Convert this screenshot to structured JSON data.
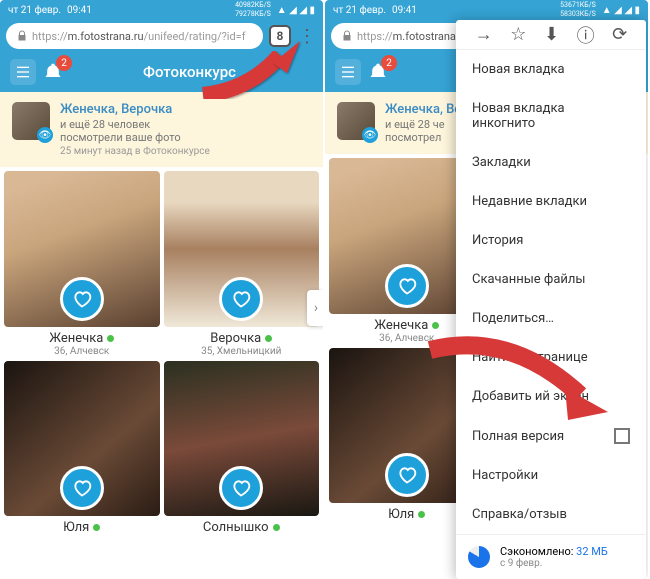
{
  "status": {
    "date": "чт 21 февр.",
    "time": "09:41",
    "net1": "40982КБ/S",
    "net2": "79278КБ/S",
    "net1b": "53671КБ/S",
    "net2b": "58303КБ/S"
  },
  "url": {
    "prefix": "https://",
    "host": "m.fotostrana.ru",
    "suffix": "/unifeed/rating/?id=f",
    "tabs": "8"
  },
  "header": {
    "title": "Фотоконкурс",
    "badge": "2"
  },
  "notice": {
    "title": "Женечка, Верочка",
    "sub1": "и ещё 28 человек",
    "sub2": "посмотрели ваше фото",
    "time": "25 минут назад в Фотоконкурсе",
    "sub1_cut": "и ещё 28 че",
    "sub2_cut": "посмотрел"
  },
  "cards": [
    {
      "name": "Женечка",
      "meta": "36, Алчевск"
    },
    {
      "name": "Верочка",
      "meta": "35, Хмельницкий"
    },
    {
      "name": "Юля",
      "meta": ""
    },
    {
      "name": "Солнышко",
      "meta": ""
    }
  ],
  "menu": {
    "items": [
      "Новая вкладка",
      "Новая вкладка инкогнито",
      "Закладки",
      "Недавние вкладки",
      "История",
      "Скачанные файлы",
      "Поделиться…",
      "Найти на странице",
      "Добавить             ий экран",
      "Полная версия",
      "Настройки",
      "Справка/отзыв"
    ],
    "saved_label": "Сэкономлено: ",
    "saved_value": "32 МБ",
    "saved_since": "с 9 февр."
  }
}
